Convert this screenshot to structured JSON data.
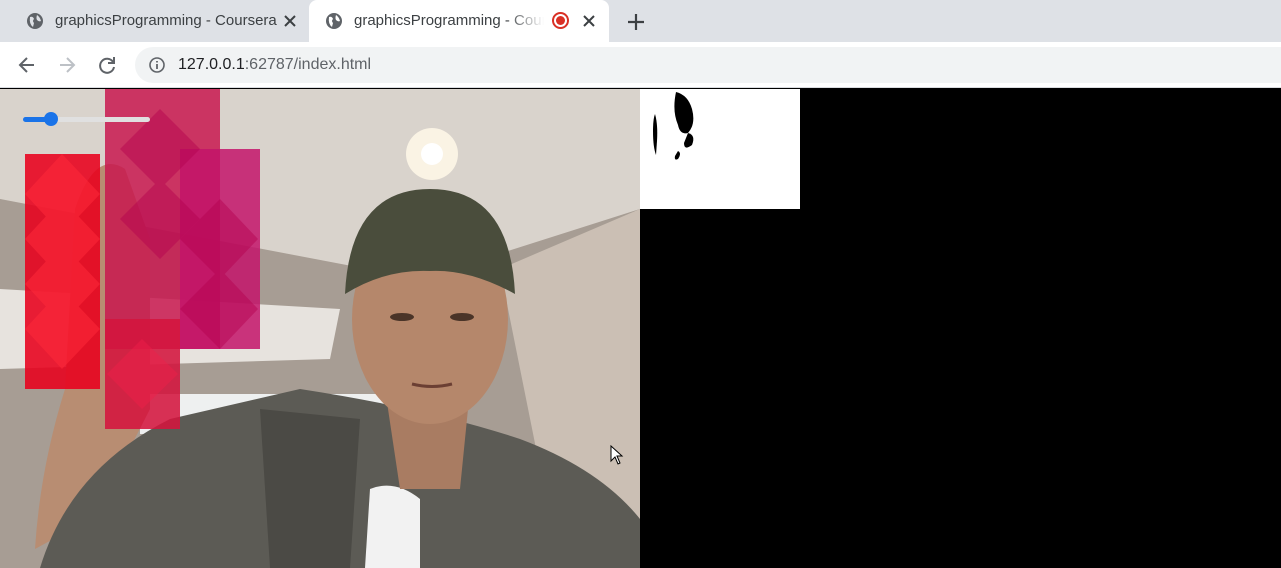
{
  "tabs": [
    {
      "title": "graphicsProgramming - Coursera"
    },
    {
      "title": "graphicsProgramming - Coursera",
      "recording": true
    }
  ],
  "toolbar": {
    "url_host": "127.0.0.1",
    "url_rest": ":62787/index.html"
  },
  "slider": {
    "value_fraction": 0.22
  },
  "colors": {
    "tabstrip": "#dee1e6",
    "accent": "#1a73e8",
    "recording": "#d93025",
    "overlay_red": "#e8001c",
    "overlay_magenta": "#c3145a"
  },
  "icons": [
    "globe-icon",
    "close-icon",
    "plus-icon",
    "back-arrow-icon",
    "forward-arrow-icon",
    "reload-icon",
    "info-icon",
    "mouse-cursor-icon"
  ]
}
